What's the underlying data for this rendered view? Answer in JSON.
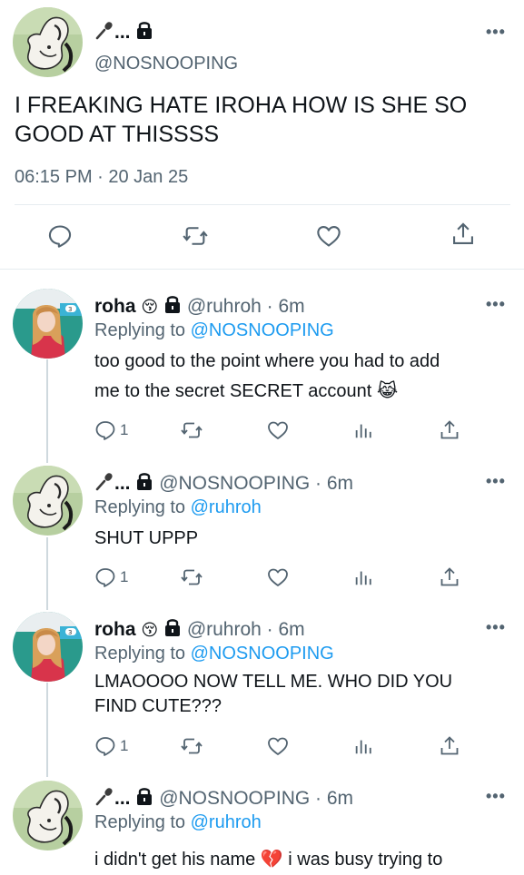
{
  "main_tweet": {
    "handle": "@NOSNOOPING",
    "text": "I FREAKING HATE IROHA HOW IS SHE SO GOOD AT THISSSS",
    "timestamp": "06:15 PM · 20 Jan 25"
  },
  "replies": [
    {
      "name": "roha",
      "handle": "@ruhroh · 6m",
      "replying_label": "Replying to",
      "replying_to": "@NOSNOOPING",
      "text_line1": "too good to the point where you had to add",
      "text_line2": "me to the secret SECRET account 😹",
      "reply_count": "1"
    },
    {
      "name": "...",
      "handle": "@NOSNOOPING · 6m",
      "replying_label": "Replying to",
      "replying_to": "@ruhroh",
      "text_line1": "SHUT UPPP",
      "reply_count": "1"
    },
    {
      "name": "roha",
      "handle": "@ruhroh · 6m",
      "replying_label": "Replying to",
      "replying_to": "@NOSNOOPING",
      "text_line1": "LMAOOOO NOW TELL ME. WHO DID YOU",
      "text_line2": "FIND CUTE???",
      "reply_count": "1"
    },
    {
      "name": "...",
      "handle": "@NOSNOOPING · 6m",
      "replying_label": "Replying to",
      "replying_to": "@ruhroh",
      "text_line1": "i didn't get his name 💔  i was busy trying to"
    }
  ],
  "colors": {
    "accent": "#1d9bf0",
    "secondary_text": "#536471",
    "divider": "#e6ecf0"
  },
  "icons": [
    "microphone-icon",
    "lock-icon",
    "more-icon",
    "reply-icon",
    "retweet-icon",
    "like-icon",
    "share-icon",
    "analytics-icon"
  ]
}
